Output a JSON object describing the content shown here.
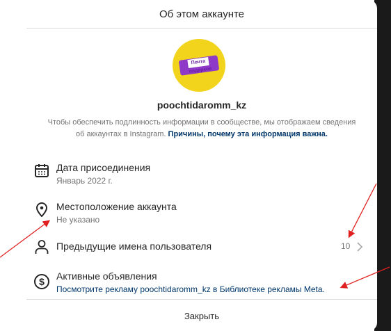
{
  "header": {
    "title": "Об этом аккаунте"
  },
  "profile": {
    "username": "poochtidaromm_kz",
    "avatar_label": "Почта подарков"
  },
  "info": {
    "text": "Чтобы обеспечить подлинность информации в сообществе, мы отображаем сведения об аккаунтах в Instagram.",
    "link": "Причины, почему эта информация важна."
  },
  "rows": [
    {
      "title": "Дата присоединения",
      "sub": "Январь 2022 г."
    },
    {
      "title": "Местоположение аккаунта",
      "sub": "Не указано"
    },
    {
      "title": "Предыдущие имена пользователя",
      "count": "10"
    },
    {
      "title": "Активные объявления",
      "sub": "Посмотрите рекламу poochtidaromm_kz в Библиотеке рекламы Meta."
    }
  ],
  "footer": {
    "close_label": "Закрыть"
  },
  "colors": {
    "link": "#00376b",
    "annotation_arrow": "#e02020",
    "text": "#262626",
    "muted": "#737373"
  }
}
